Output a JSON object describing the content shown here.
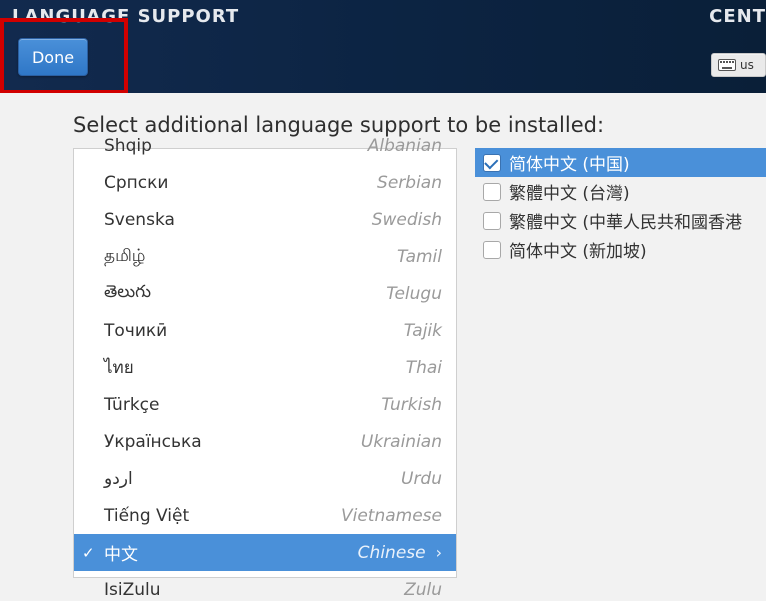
{
  "banner": {
    "title": "LANGUAGE SUPPORT",
    "right_fragment": "CENT",
    "done_label": "Done",
    "kbd_frag": "us"
  },
  "content": {
    "instruction": "Select additional language support to be installed:"
  },
  "languages": [
    {
      "native": "Shqip",
      "english": "Albanian",
      "selected": false
    },
    {
      "native": "Српски",
      "english": "Serbian",
      "selected": false
    },
    {
      "native": "Svenska",
      "english": "Swedish",
      "selected": false
    },
    {
      "native": "தமிழ்",
      "english": "Tamil",
      "selected": false
    },
    {
      "native": "తెలుగు",
      "english": "Telugu",
      "selected": false
    },
    {
      "native": "Точикӣ",
      "english": "Tajik",
      "selected": false
    },
    {
      "native": "ไทย",
      "english": "Thai",
      "selected": false
    },
    {
      "native": "Türkçe",
      "english": "Turkish",
      "selected": false
    },
    {
      "native": "Українська",
      "english": "Ukrainian",
      "selected": false
    },
    {
      "native": "اردو",
      "english": "Urdu",
      "selected": false
    },
    {
      "native": "Tiếng Việt",
      "english": "Vietnamese",
      "selected": false
    },
    {
      "native": "中文",
      "english": "Chinese",
      "selected": true
    },
    {
      "native": "IsiZulu",
      "english": "Zulu",
      "selected": false
    }
  ],
  "locales": [
    {
      "label": "简体中文 (中国)",
      "checked": true,
      "selected": true
    },
    {
      "label": "繁體中文 (台灣)",
      "checked": false,
      "selected": false
    },
    {
      "label": "繁體中文 (中華人民共和國香港",
      "checked": false,
      "selected": false
    },
    {
      "label": "简体中文 (新加坡)",
      "checked": false,
      "selected": false
    }
  ]
}
